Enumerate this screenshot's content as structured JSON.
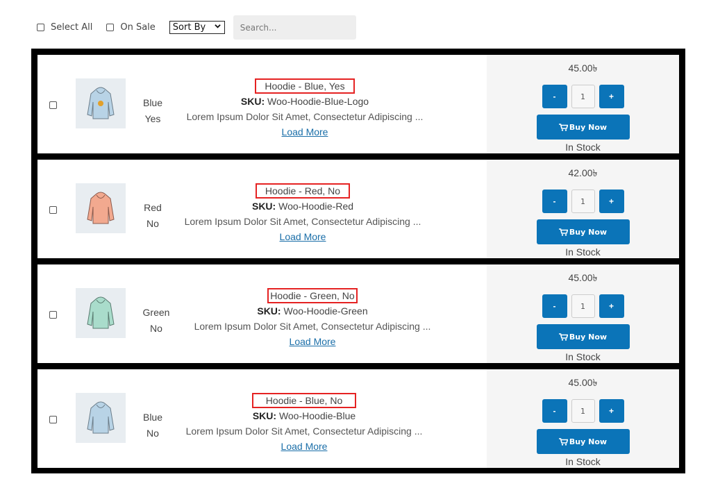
{
  "toolbar": {
    "select_all_label": "Select All",
    "on_sale_label": "On Sale",
    "sort_selected": "Sort By",
    "search_placeholder": "Search..."
  },
  "labels": {
    "sku_prefix": "SKU:",
    "load_more": "Load More",
    "buy_now": "Buy Now",
    "minus": "-",
    "plus": "+"
  },
  "colors": {
    "accent": "#0b74b8",
    "title_highlight": "#e52222",
    "frame": "#000000"
  },
  "products": [
    {
      "color": "Blue",
      "logo": "Yes",
      "title": "Hoodie - Blue, Yes",
      "sku": "Woo-Hoodie-Blue-Logo",
      "description": "Lorem Ipsum Dolor Sit Amet, Consectetur Adipiscing ...",
      "price": "45.00৳",
      "quantity": "1",
      "stock": "In Stock",
      "image_icon": "hoodie-blue-logo-icon",
      "hoodie_color": "#b8d3e6"
    },
    {
      "color": "Red",
      "logo": "No",
      "title": "Hoodie - Red, No",
      "sku": "Woo-Hoodie-Red",
      "description": "Lorem Ipsum Dolor Sit Amet, Consectetur Adipiscing ...",
      "price": "42.00৳",
      "quantity": "1",
      "stock": "In Stock",
      "image_icon": "hoodie-red-icon",
      "hoodie_color": "#f2a98f"
    },
    {
      "color": "Green",
      "logo": "No",
      "title": "Hoodie - Green, No",
      "sku": "Woo-Hoodie-Green",
      "description": "Lorem Ipsum Dolor Sit Amet, Consectetur Adipiscing ...",
      "price": "45.00৳",
      "quantity": "1",
      "stock": "In Stock",
      "image_icon": "hoodie-green-icon",
      "hoodie_color": "#a9dccb"
    },
    {
      "color": "Blue",
      "logo": "No",
      "title": "Hoodie - Blue, No",
      "sku": "Woo-Hoodie-Blue",
      "description": "Lorem Ipsum Dolor Sit Amet, Consectetur Adipiscing ...",
      "price": "45.00৳",
      "quantity": "1",
      "stock": "In Stock",
      "image_icon": "hoodie-blue-icon",
      "hoodie_color": "#b8d3e6"
    }
  ]
}
